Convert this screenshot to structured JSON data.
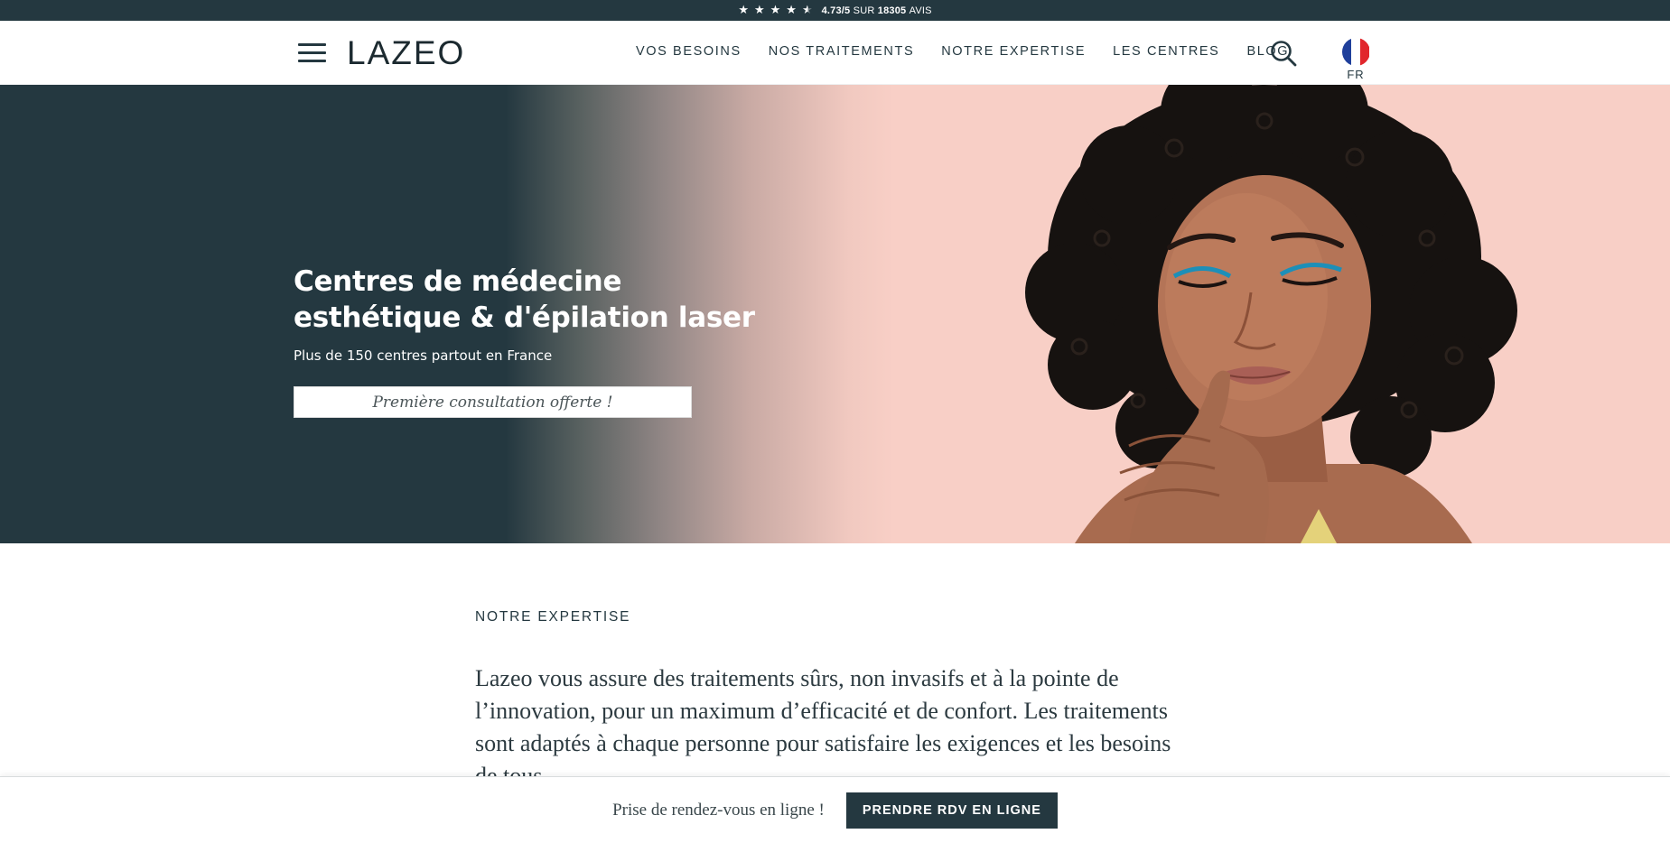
{
  "topbar": {
    "rating": "4.73/5",
    "sur_label": "SUR",
    "count": "18305",
    "avis_label": "AVIS",
    "stars_value": 4.73,
    "stars_max": 5
  },
  "header": {
    "logo": "LAZEO",
    "nav": [
      {
        "label": "VOS BESOINS"
      },
      {
        "label": "NOS TRAITEMENTS"
      },
      {
        "label": "NOTRE EXPERTISE"
      },
      {
        "label": "LES CENTRES"
      },
      {
        "label": "BLOG"
      }
    ],
    "language": "FR",
    "icons": [
      "menu-icon",
      "search-icon",
      "france-flag-icon"
    ]
  },
  "hero": {
    "title_line1": "Centres de médecine",
    "title_line2": "esthétique & d'épilation laser",
    "subtitle": "Plus de 150 centres partout en France",
    "cta": "Première consultation offerte !"
  },
  "expertise": {
    "label": "NOTRE EXPERTISE",
    "text": "Lazeo vous assure des traitements sûrs, non invasifs et à la pointe de l’innovation, pour un maximum d’efficacité et de confort. Les traitements sont adaptés à chaque personne pour satisfaire les exigences et les besoins de tous."
  },
  "sticky_bar": {
    "text": "Prise de rendez-vous en ligne !",
    "button": "PRENDRE RDV EN LIGNE"
  },
  "colors": {
    "primary": "#243840",
    "hero_pink": "#f8cfc6",
    "white": "#ffffff"
  }
}
